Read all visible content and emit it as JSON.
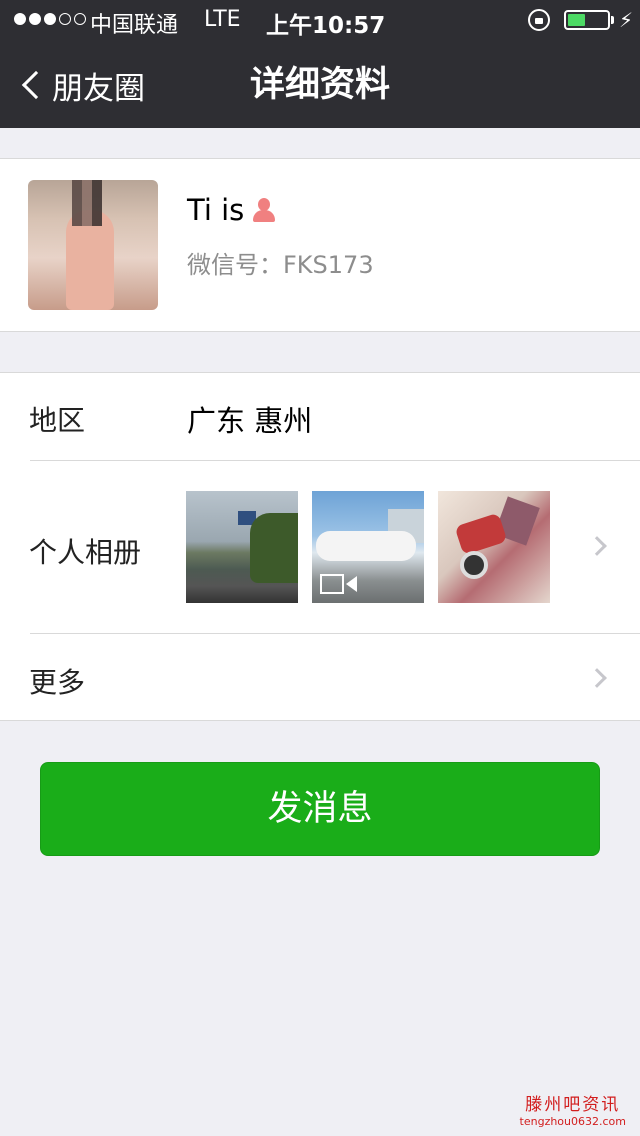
{
  "status_bar": {
    "carrier": "中国联通",
    "network": "LTE",
    "time": "上午10:57",
    "signal_dots_filled": 3,
    "signal_dots_total": 5,
    "battery_level": 0.45,
    "battery_color": "#4cd964"
  },
  "nav": {
    "back_label": "朋友圈",
    "title": "详细资料"
  },
  "profile": {
    "name": "Ti is",
    "gender_icon": "female-icon",
    "wechat_id": "微信号：FKS173"
  },
  "info": {
    "region_label": "地区",
    "region_value": "广东 惠州",
    "album_label": "个人相册",
    "album_photos": [
      {
        "description_icon": "photo"
      },
      {
        "description_icon": "video-photo"
      },
      {
        "description_icon": "photo"
      }
    ],
    "more_label": "更多"
  },
  "actions": {
    "send_message": "发消息"
  },
  "watermark": {
    "title": "滕州吧资讯",
    "url": "tengzhou0632.com"
  },
  "colors": {
    "header_bg": "#2e2e33",
    "page_bg": "#efeff4",
    "primary_button": "#1aad19",
    "female_icon": "#f08080"
  }
}
